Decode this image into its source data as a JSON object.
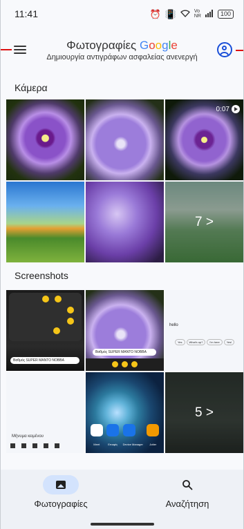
{
  "status_bar": {
    "time": "11:41",
    "battery": "100",
    "icons": [
      "alarm-icon",
      "vibrate-icon",
      "wifi-icon",
      "volte-icon",
      "signal-icon",
      "battery-icon"
    ]
  },
  "header": {
    "title": "Φωτογραφίες",
    "google_letters": [
      "G",
      "o",
      "o",
      "g",
      "l",
      "e"
    ],
    "subtitle": "Δημιουργία αντιγράφων ασφαλείας ανενεργή",
    "menu_icon": "hamburger-menu-icon",
    "account_icon": "account-circle-icon"
  },
  "sections": [
    {
      "title": "Κάμερα",
      "tiles": [
        {
          "kind": "flower"
        },
        {
          "kind": "flower"
        },
        {
          "kind": "video",
          "duration": "0:07"
        },
        {
          "kind": "park"
        },
        {
          "kind": "petal"
        },
        {
          "kind": "more",
          "more_label": "7 >"
        }
      ]
    },
    {
      "title": "Screenshots",
      "tiles": [
        {
          "kind": "ss-dark",
          "snackbar": "Βαθμός SUPER ΜΑΝΤΟ ΝΟΒΒΑ"
        },
        {
          "kind": "ss-flower",
          "snackbar": "Βαθμός SUPER ΜΑΝΤΟ ΝΟΒΒΑ"
        },
        {
          "kind": "ss-chat",
          "message": "hello",
          "replies": [
            "Yes",
            "What's up?",
            "I'm here",
            "Yes!"
          ]
        },
        {
          "kind": "ss-light",
          "input_placeholder": "Μήνυμα κειμένου"
        },
        {
          "kind": "ss-space",
          "apps": [
            "Meet",
            "Επαφές",
            "Device Manager",
            "Jotter"
          ]
        },
        {
          "kind": "more",
          "more_label": "5 >"
        }
      ]
    }
  ],
  "bottom_nav": {
    "photos_label": "Φωτογραφίες",
    "search_label": "Αναζήτηση"
  },
  "colors": {
    "accent": "#1a4fd8",
    "nav_active": "#d3e3fd",
    "callout": "#dd1111"
  }
}
